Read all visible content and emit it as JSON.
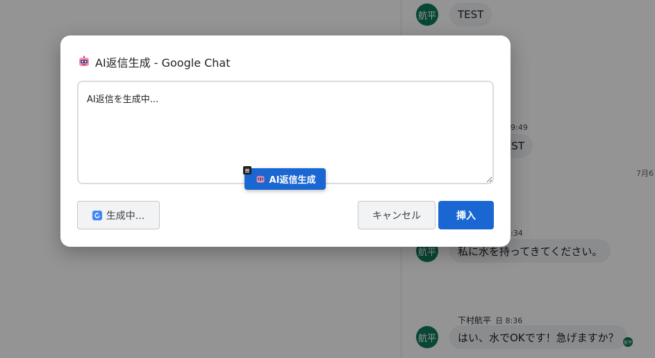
{
  "chat": {
    "avatar_label": "航平",
    "messages": [
      {
        "text": "TEST"
      },
      {
        "time_fragment": "9:49",
        "text_fragment": "EST"
      },
      {
        "time_fragment": ":34",
        "text": "私に水を持ってきてください。"
      },
      {
        "sender": "下村航平",
        "time": "日 8:36",
        "text": "はい、水でOKです！急げますか？"
      }
    ],
    "date_divider_fragment": "7月6",
    "reader_avatar_label": "航平"
  },
  "dialog": {
    "title": "AI返信生成 - Google Chat",
    "title_icon": "robot-icon",
    "reply_text": "AI返信を生成中...",
    "generate_button_label": "生成中...",
    "generate_button_icon": "refresh-icon",
    "cancel_label": "キャンセル",
    "insert_label": "挿入"
  },
  "floating_button": {
    "label": "AI返信生成",
    "icon": "robot-icon",
    "menu_icon": "menu-icon"
  },
  "colors": {
    "primary": "#1a66d2",
    "avatar_green": "#0f7a5c",
    "bubble_bg": "#f0f2f4"
  }
}
